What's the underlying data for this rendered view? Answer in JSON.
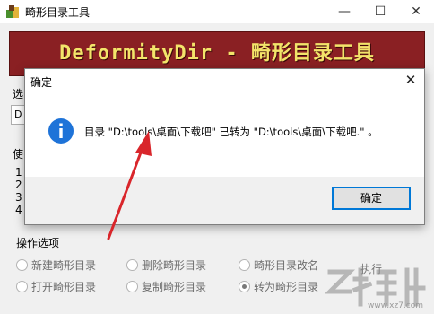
{
  "window": {
    "title": "畸形目录工具",
    "minimize_glyph": "—",
    "maximize_glyph": "☐",
    "close_glyph": "✕"
  },
  "banner": {
    "text": "DeformityDir - 畸形目录工具"
  },
  "left_fragments": {
    "select_label": "选",
    "input_char": "D",
    "usage_label": "使",
    "list": [
      "1",
      "2",
      "3",
      "4"
    ]
  },
  "ops": {
    "group_title": "操作选项",
    "options": [
      {
        "label": "新建畸形目录",
        "checked": false
      },
      {
        "label": "删除畸形目录",
        "checked": false
      },
      {
        "label": "畸形目录改名",
        "checked": false
      },
      {
        "label": "打开畸形目录",
        "checked": false
      },
      {
        "label": "复制畸形目录",
        "checked": false
      },
      {
        "label": "转为畸形目录",
        "checked": true
      }
    ],
    "execute_label": "执行"
  },
  "dialog": {
    "title": "确定",
    "close_glyph": "✕",
    "message": "目录 \"D:\\tools\\桌面\\下载吧\" 已转为 \"D:\\tools\\桌面\\下载吧.\" 。",
    "ok_label": "确定",
    "icon": "info-icon"
  },
  "watermark": {
    "url": "www.xz7.com"
  },
  "colors": {
    "banner_bg": "#8a2023",
    "banner_text": "#f3e46a",
    "info_blue": "#1e73d8",
    "arrow_red": "#d9262b",
    "focus_blue": "#0078d7"
  }
}
